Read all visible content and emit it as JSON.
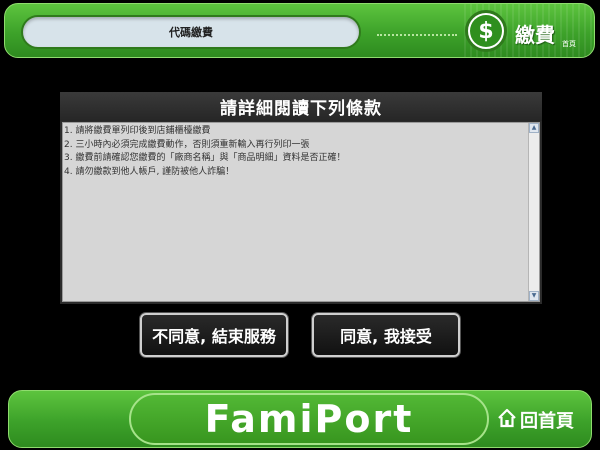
{
  "header": {
    "title": "代碼繳費",
    "category_symbol": "$",
    "category_label": "繳費",
    "home_link": "首頁"
  },
  "terms": {
    "heading": "請詳細閱讀下列條款",
    "items": [
      "1. 請將繳費單列印後到店鋪櫃檯繳費",
      "2. 三小時內必須完成繳費動作，否則須重新輸入再行列印一張",
      "3. 繳費前請確認您繳費的「廠商名稱」與「商品明細」資料是否正確！",
      "4. 請勿繳款到他人帳戶, 謹防被他人詐騙！"
    ]
  },
  "buttons": {
    "decline_label": "不同意, 結束服務",
    "accept_label": "同意, 我接受"
  },
  "footer": {
    "brand": "FamiPort",
    "home_label": "回首頁"
  },
  "colors": {
    "brand_green": "#3da22a",
    "background": "#000000",
    "terms_background": "#d6d6d6"
  }
}
